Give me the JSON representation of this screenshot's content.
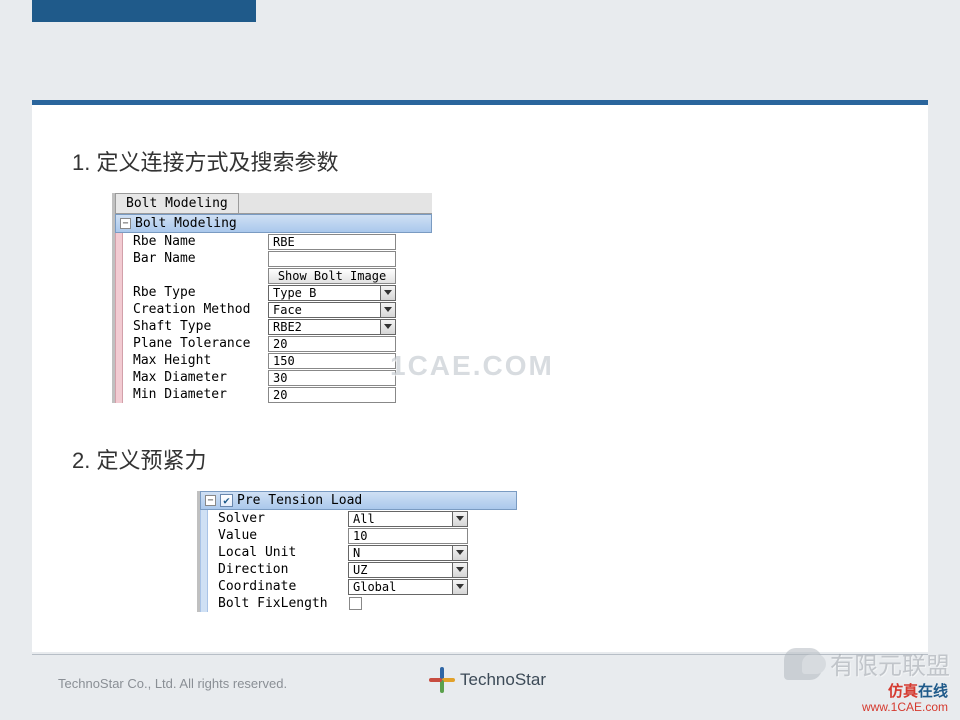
{
  "section1": {
    "title": "1. 定义连接方式及搜索参数",
    "tab_label": "Bolt Modeling",
    "group_header": "Bolt Modeling",
    "rows": {
      "rbe_name_label": "Rbe Name",
      "rbe_name_value": "RBE",
      "bar_name_label": "Bar Name",
      "bar_name_value": "",
      "show_image_btn": "Show Bolt Image",
      "rbe_type_label": "Rbe Type",
      "rbe_type_value": "Type B",
      "creation_method_label": "Creation Method",
      "creation_method_value": "Face",
      "shaft_type_label": "Shaft Type",
      "shaft_type_value": "RBE2",
      "plane_tol_label": "Plane Tolerance",
      "plane_tol_value": "20",
      "max_height_label": "Max Height",
      "max_height_value": "150",
      "max_diameter_label": "Max Diameter",
      "max_diameter_value": "30",
      "min_diameter_label": "Min Diameter",
      "min_diameter_value": "20"
    }
  },
  "section2": {
    "title": "2. 定义预紧力",
    "group_header": "Pre Tension Load",
    "group_checked": true,
    "rows": {
      "solver_label": "Solver",
      "solver_value": "All",
      "value_label": "Value",
      "value_value": "10",
      "local_unit_label": "Local Unit",
      "local_unit_value": "N",
      "direction_label": "Direction",
      "direction_value": "UZ",
      "coordinate_label": "Coordinate",
      "coordinate_value": "Global",
      "fixlength_label": "Bolt FixLength"
    }
  },
  "watermark": "1CAE.COM",
  "footer": {
    "copyright": "TechnoStar Co., Ltd. All rights reserved.",
    "logo_text": "TechnoStar",
    "wechat_text": "有限元联盟",
    "site_name_a": "仿真",
    "site_name_b": "在线",
    "site_url": "www.1CAE.com"
  }
}
